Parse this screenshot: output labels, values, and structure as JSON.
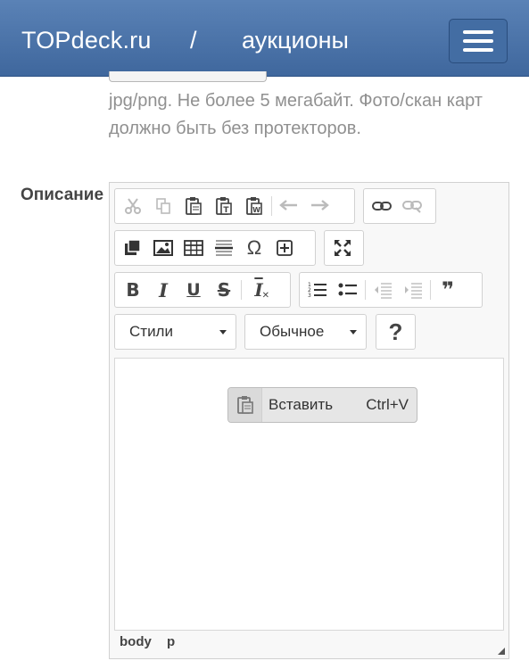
{
  "navbar": {
    "brand": "TOPdeck.ru",
    "separator": "/",
    "section": "аукционы",
    "menu_icon": "hamburger-icon"
  },
  "upload": {
    "help_text": "jpg/png. Не более 5 мегабайт. Фото/скан карт должно быть без протекторов."
  },
  "description": {
    "label": "Описание"
  },
  "toolbar": {
    "row1_group1": [
      "cut-icon",
      "copy-icon",
      "paste-icon",
      "paste-text-icon",
      "paste-word-icon",
      "undo-icon",
      "redo-icon"
    ],
    "row1_group2": [
      "link-icon",
      "unlink-icon"
    ],
    "row2_group1": [
      "media-icon",
      "image-icon",
      "table-icon",
      "horizontal-line-icon",
      "special-char-icon",
      "insert-plus-icon"
    ],
    "row2_group2": [
      "maximize-icon"
    ],
    "row3_group1": [
      "bold-icon",
      "italic-icon",
      "underline-icon",
      "strike-icon",
      "remove-format-icon"
    ],
    "row3_group2": [
      "numbered-list-icon",
      "bulleted-list-icon",
      "outdent-icon",
      "indent-icon",
      "blockquote-icon"
    ],
    "bold": "B",
    "italic": "I",
    "underline": "U",
    "strike": "S",
    "remove_format": "I",
    "special_char": "Ω",
    "blockquote": "❞",
    "styles_label": "Стили",
    "format_label": "Обычное",
    "help_label": "?"
  },
  "context_menu": {
    "icon": "paste-icon",
    "label": "Вставить",
    "shortcut": "Ctrl+V"
  },
  "path_bar": [
    "body",
    "p"
  ]
}
